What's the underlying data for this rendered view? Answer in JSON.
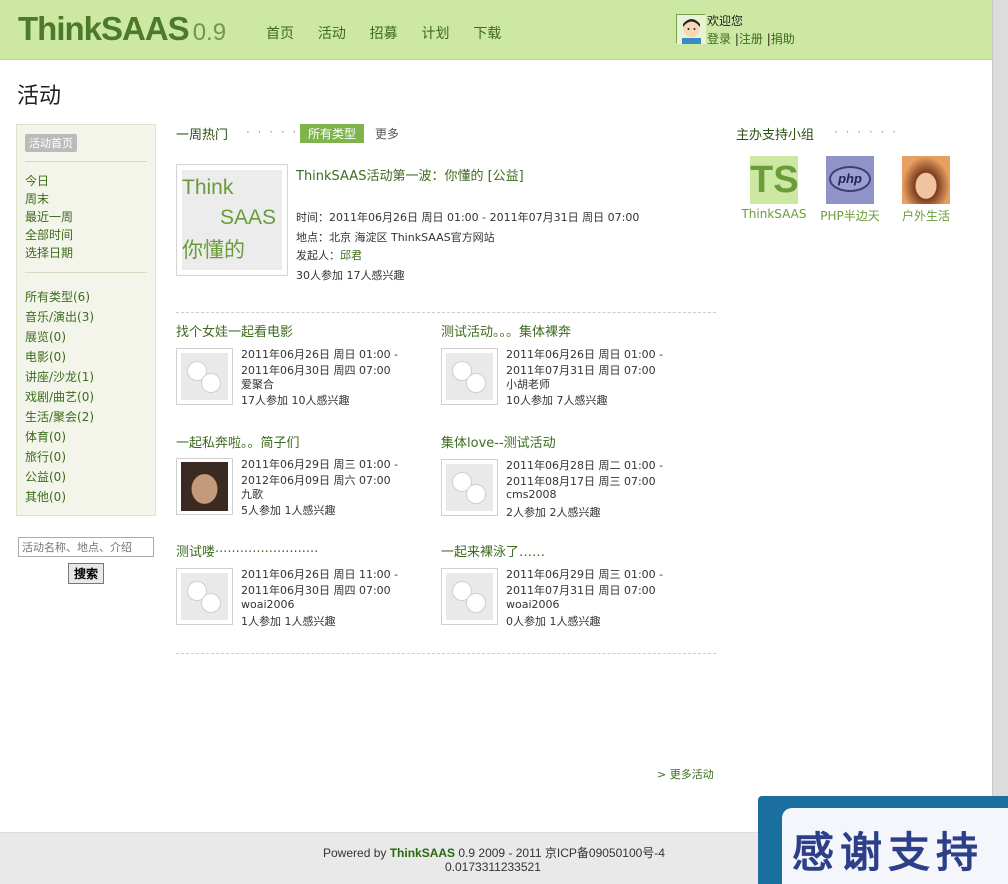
{
  "header": {
    "brand": "ThinkSAAS",
    "version": "0.9",
    "nav": [
      "首页",
      "活动",
      "招募",
      "计划",
      "下载"
    ],
    "welcome": "欢迎您",
    "login": "登录",
    "register": "注册",
    "donate": "捐助"
  },
  "page_title": "活动",
  "sidebar": {
    "home": "活动首页",
    "time_filters": [
      "今日",
      "周末",
      "最近一周",
      "全部时间",
      "选择日期"
    ],
    "categories": [
      "所有类型(6)",
      "音乐/演出(3)",
      "展览(0)",
      "电影(0)",
      "讲座/沙龙(1)",
      "戏剧/曲艺(0)",
      "生活/聚会(2)",
      "体育(0)",
      "旅行(0)",
      "公益(0)",
      "其他(0)"
    ],
    "search_placeholder": "活动名称、地点、介绍",
    "search_button": "搜索"
  },
  "hot": {
    "title": "一周热门",
    "dots": "· · · · · ·",
    "tag": "所有类型",
    "more": "更多"
  },
  "featured": {
    "img_t1": "Think",
    "img_t2": "SAAS",
    "img_t3": "你懂的",
    "title": "ThinkSAAS活动第一波：你懂的  [公益]",
    "time": "时间：2011年06月26日  周日  01:00 - 2011年07月31日  周日  07:00",
    "place": "地点：北京  海淀区  ThinkSAAS官方网站",
    "organizer_label": "发起人：",
    "organizer": "邱君",
    "stats": "30人参加    17人感兴趣"
  },
  "events": [
    {
      "title": "找个女娃一起看电影",
      "l1": "2011年06月26日  周日  01:00 -",
      "l2": "2011年06月30日  周四  07:00",
      "user": "爱聚合",
      "stats": "17人参加    10人感兴趣",
      "photo": false
    },
    {
      "title": "测试活动。。。集体裸奔",
      "l1": "2011年06月26日  周日  01:00 -",
      "l2": "2011年07月31日  周日  07:00",
      "user": "小胡老师",
      "stats": "10人参加    7人感兴趣",
      "photo": false
    },
    {
      "title": "一起私奔啦。。简子们",
      "l1": "2011年06月29日  周三  01:00 -",
      "l2": "2012年06月09日  周六  07:00",
      "user": "九歌",
      "stats": "5人参加    1人感兴趣",
      "photo": true
    },
    {
      "title": "集体love--测试活动",
      "l1": "2011年06月28日  周二  01:00 -",
      "l2": "2011年08月17日  周三  07:00",
      "user": "cms2008",
      "stats": "2人参加    2人感兴趣",
      "photo": false
    },
    {
      "title": "测试喽·························",
      "l1": "2011年06月26日  周日  11:00 -",
      "l2": "2011年06月30日  周四  07:00",
      "user": "woai2006",
      "stats": "1人参加    1人感兴趣",
      "photo": false
    },
    {
      "title": "一起来裸泳了……",
      "l1": "2011年06月29日  周三  01:00 -",
      "l2": "2011年07月31日  周日  07:00",
      "user": "woai2006",
      "stats": "0人参加    1人感兴趣",
      "photo": false
    }
  ],
  "more_events": "> 更多活动",
  "groups": {
    "title": "主办支持小组",
    "dots": "· · · · · ·",
    "items": [
      {
        "name": "ThinkSAAS",
        "pic": "TS"
      },
      {
        "name": "PHP半边天",
        "pic": "php"
      },
      {
        "name": "户外生活",
        "pic": ""
      }
    ]
  },
  "footer": {
    "powered": "Powered by ",
    "brand": "ThinkSAAS",
    "rest": " 0.9 2009 - 2011 京ICP备09050100号-4",
    "time": "0.0173311233521"
  },
  "float_ad": "感谢支持"
}
